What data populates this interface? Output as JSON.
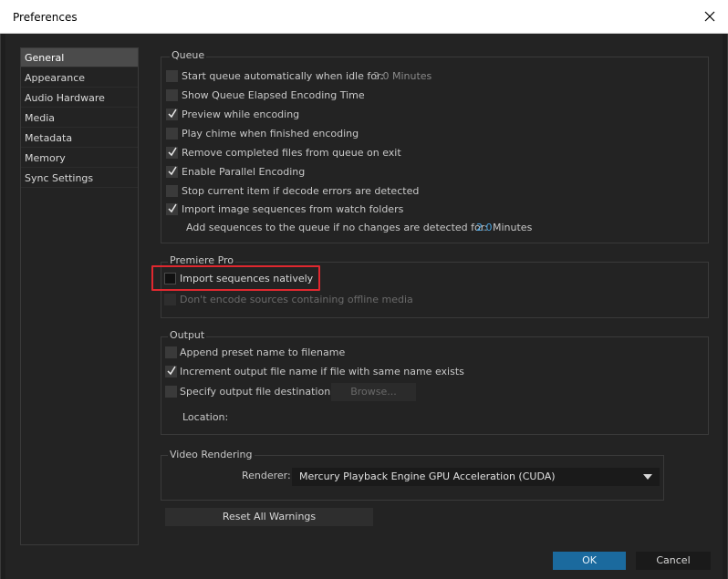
{
  "window": {
    "title": "Preferences",
    "close_icon": "close-icon"
  },
  "sidebar": {
    "items": [
      {
        "label": "General",
        "selected": true
      },
      {
        "label": "Appearance"
      },
      {
        "label": "Audio Hardware"
      },
      {
        "label": "Media"
      },
      {
        "label": "Metadata"
      },
      {
        "label": "Memory"
      },
      {
        "label": "Sync Settings"
      }
    ]
  },
  "queue": {
    "title": "Queue",
    "start_idle_label": "Start queue automatically when idle for:",
    "start_idle_value": "2.0 Minutes",
    "elapsed_label": "Show Queue Elapsed Encoding Time",
    "preview_label": "Preview while encoding",
    "chime_label": "Play chime when finished encoding",
    "remove_label": "Remove completed files from queue on exit",
    "parallel_label": "Enable Parallel Encoding",
    "stop_label": "Stop current item if decode errors are detected",
    "import_label": "Import image sequences from watch folders",
    "add_seq_label": "Add sequences to the queue if no changes are detected for:",
    "add_seq_value": "2.0",
    "add_seq_unit": "Minutes",
    "checked": {
      "start_idle": false,
      "elapsed": false,
      "preview": true,
      "chime": false,
      "remove": true,
      "parallel": true,
      "stop": false,
      "import": true
    }
  },
  "premiere": {
    "title": "Premiere Pro",
    "import_native_label": "Import sequences natively",
    "offline_label": "Don't encode sources containing offline media",
    "checked": {
      "import_native": false,
      "offline": false
    }
  },
  "output": {
    "title": "Output",
    "append_label": "Append preset name to filename",
    "increment_label": "Increment output file name if file with same name exists",
    "specify_label": "Specify output file destination:",
    "browse_label": "Browse...",
    "location_label": "Location:",
    "checked": {
      "append": false,
      "increment": true,
      "specify": false
    }
  },
  "rendering": {
    "title": "Video Rendering",
    "renderer_label": "Renderer:",
    "renderer_value": "Mercury Playback Engine GPU Acceleration (CUDA)"
  },
  "buttons": {
    "reset_warnings": "Reset All Warnings",
    "ok": "OK",
    "cancel": "Cancel"
  },
  "colors": {
    "accent": "#1b6a9e",
    "highlight": "#e0282f",
    "value_blue": "#4aa3df"
  }
}
